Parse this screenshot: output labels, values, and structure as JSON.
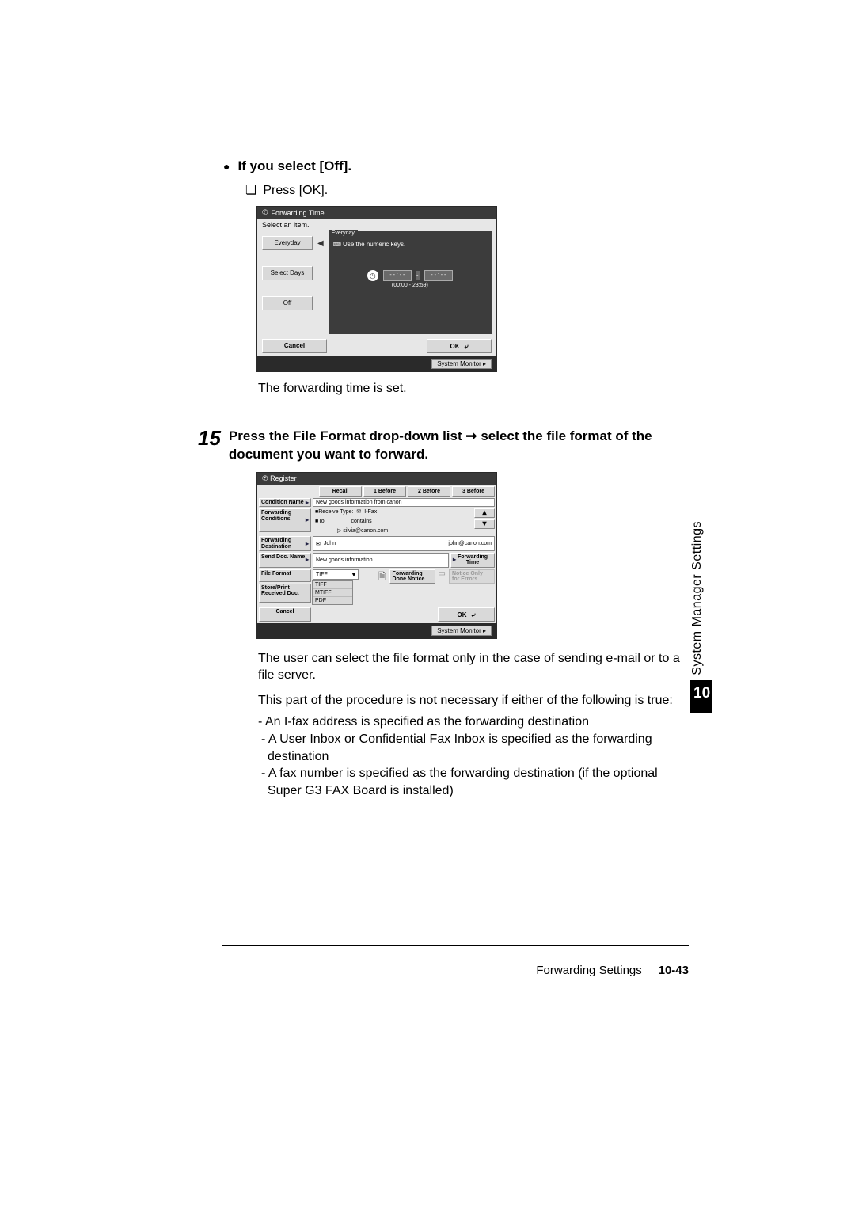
{
  "section1": {
    "heading": "If you select [Off].",
    "press_ok": "Press [OK].",
    "caption": "The forwarding time is set."
  },
  "shot1": {
    "title": "Forwarding Time",
    "subhead": "Select an item.",
    "tabs": [
      "Everyday",
      "Select Days",
      "Off"
    ],
    "active_tab": "Everyday",
    "hint": "Use the numeric keys.",
    "time_left": "- - : - -",
    "time_right": "- - : - -",
    "time_range": "(00:00 - 23:59)",
    "cancel": "Cancel",
    "ok": "OK",
    "system_monitor": "System Monitor  ▸"
  },
  "step15": {
    "num": "15",
    "text": "Press the File Format drop-down list ➞ select the file format of the document you want to forward."
  },
  "shot2": {
    "title": "Register",
    "top_tabs": [
      "Recall",
      "1 Before",
      "2 Before",
      "3 Before"
    ],
    "rows": {
      "condition_name": {
        "label": "Condition Name",
        "value": "New goods information from canon"
      },
      "forwarding_conditions": {
        "label": "Forwarding Conditions",
        "line1a": "■Receive Type:",
        "line1b": "I-Fax",
        "line2a": "■To:",
        "line2b": "contains",
        "line3": "▷ silvia@canon.com"
      },
      "forwarding_destination": {
        "label": "Forwarding Destination",
        "name": "John",
        "email": "john@canon.com"
      },
      "send_doc": {
        "label": "Send Doc. Name",
        "value": "New goods information",
        "time_btn": "Forwarding Time"
      },
      "file_format": {
        "label": "File Format",
        "selected": "TIFF",
        "options": [
          "TIFF",
          "MTIFF",
          "PDF"
        ]
      },
      "store_print": {
        "label": "Store/Print Received Doc."
      },
      "done_notice": {
        "label": "Forwarding Done Notice",
        "notice_only": "Notice Only for Errors"
      }
    },
    "cancel": "Cancel",
    "ok": "OK",
    "system_monitor": "System Monitor  ▸"
  },
  "explain": {
    "p1": "The user can select the file format only in the case of sending e-mail or to a file server.",
    "p2": "This part of the procedure is not necessary if either of the following is true:",
    "b1": "An I-fax address is specified as the forwarding destination",
    "b2": "A User Inbox or Confidential Fax Inbox is specified as the forwarding destination",
    "b3": "A fax number is specified as the forwarding destination (if the optional Super G3 FAX Board is installed)"
  },
  "side": {
    "label": "System Manager Settings",
    "chapter": "10"
  },
  "footer": {
    "section": "Forwarding Settings",
    "page": "10-43"
  }
}
